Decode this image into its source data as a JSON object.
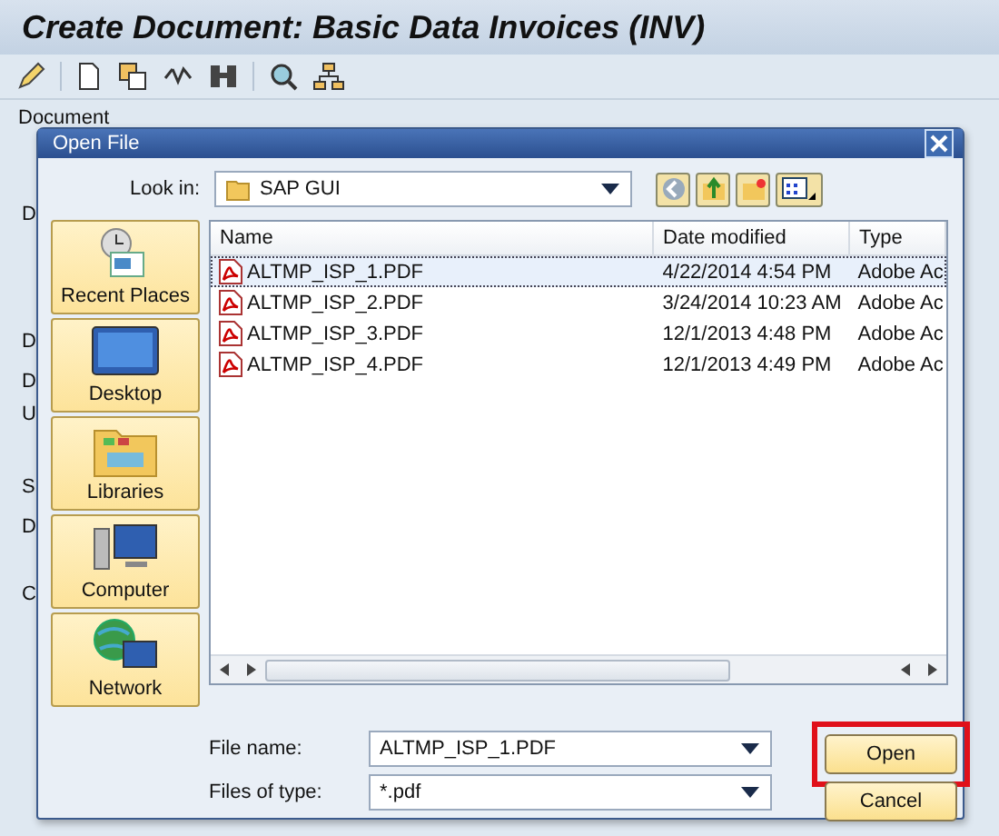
{
  "window": {
    "title": "Create Document: Basic Data Invoices (INV)"
  },
  "background": {
    "section_title": "Document",
    "labels": [
      "D",
      "D",
      "D",
      "U",
      "S",
      "D",
      "C"
    ]
  },
  "dialog": {
    "title": "Open File",
    "look_in": {
      "label": "Look in:",
      "value": "SAP GUI"
    },
    "places": [
      {
        "label": "Recent Places",
        "kind": "recent"
      },
      {
        "label": "Desktop",
        "kind": "desktop"
      },
      {
        "label": "Libraries",
        "kind": "libraries"
      },
      {
        "label": "Computer",
        "kind": "computer"
      },
      {
        "label": "Network",
        "kind": "network"
      }
    ],
    "columns": [
      "Name",
      "Date modified",
      "Type"
    ],
    "files": [
      {
        "name": "ALTMP_ISP_1.PDF",
        "date": "4/22/2014 4:54 PM",
        "type": "Adobe Ac",
        "selected": true
      },
      {
        "name": "ALTMP_ISP_2.PDF",
        "date": "3/24/2014 10:23 AM",
        "type": "Adobe Ac",
        "selected": false
      },
      {
        "name": "ALTMP_ISP_3.PDF",
        "date": "12/1/2013 4:48 PM",
        "type": "Adobe Ac",
        "selected": false
      },
      {
        "name": "ALTMP_ISP_4.PDF",
        "date": "12/1/2013 4:49 PM",
        "type": "Adobe Ac",
        "selected": false
      }
    ],
    "file_name": {
      "label": "File name:",
      "value": "ALTMP_ISP_1.PDF"
    },
    "file_type": {
      "label": "Files of type:",
      "value": "*.pdf"
    },
    "buttons": [
      {
        "label": "Open",
        "highlighted": true
      },
      {
        "label": "Cancel",
        "highlighted": false
      }
    ]
  }
}
